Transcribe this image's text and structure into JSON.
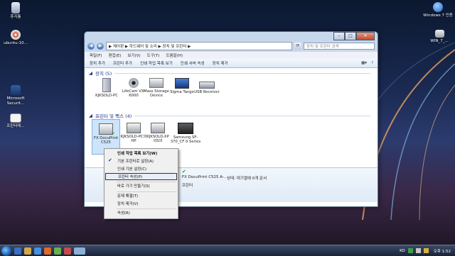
{
  "desktop": {
    "icons": [
      {
        "label": "휴지통"
      },
      {
        "label": "ubuntu-10..."
      },
      {
        "label": "Microsoft Securit..."
      },
      {
        "label": "프린터테..."
      },
      {
        "label": "Windows 7 인증"
      },
      {
        "label": "WIN_7_..."
      }
    ]
  },
  "window": {
    "address": "▶ 제어판 ▶ 하드웨어 및 소리 ▶ 장치 및 프린터 ▶",
    "search_placeholder": "장치 및 프린터 검색",
    "menu": [
      "파일(F)",
      "편집(E)",
      "보기(V)",
      "도구(T)",
      "도움말(H)"
    ],
    "toolbar": [
      "장치 추가",
      "프린터 추가",
      "인쇄 작업 목록 보기",
      "인쇄 서버 속성",
      "장치 제거"
    ],
    "sections": {
      "devices_header": "장치 (5)",
      "printers_header": "프린터 및 팩스 (4)"
    },
    "devices": [
      {
        "label": "KJKSOLD-PC"
      },
      {
        "label": "LifeCam VX-6000"
      },
      {
        "label": "Mass Storage Device"
      },
      {
        "label": "Sigma Tango"
      },
      {
        "label": "USB Receiver"
      }
    ],
    "printers": [
      {
        "label": "FX DocuPrint C525"
      },
      {
        "label": "KJKSOLD-PC의 HP"
      },
      {
        "label": "KJKSOLD-XP 의S의"
      },
      {
        "label": "Samsung SF-370_CF 0 Series"
      }
    ],
    "details": {
      "name": "FX DocuPrint C525 A-...",
      "category": "프린터",
      "state": "상태: 대기열에 0개 문서"
    }
  },
  "context_menu": {
    "items": [
      {
        "label": "인쇄 작업 목록 보기(W)",
        "bold": true
      },
      {
        "label": "기본 프린터로 설정(A)",
        "checked": true
      },
      {
        "label": "인쇄 기본 설정(C)"
      },
      {
        "label": "프린터 속성(P)",
        "highlighted": true
      },
      {
        "label": "바로 가기 만들기(S)"
      },
      {
        "label": "문제 해결(T)"
      },
      {
        "label": "장치 제거(V)"
      },
      {
        "label": "속성(R)"
      }
    ]
  },
  "taskbar": {
    "language": "KO",
    "clock": "오후 1:52"
  }
}
